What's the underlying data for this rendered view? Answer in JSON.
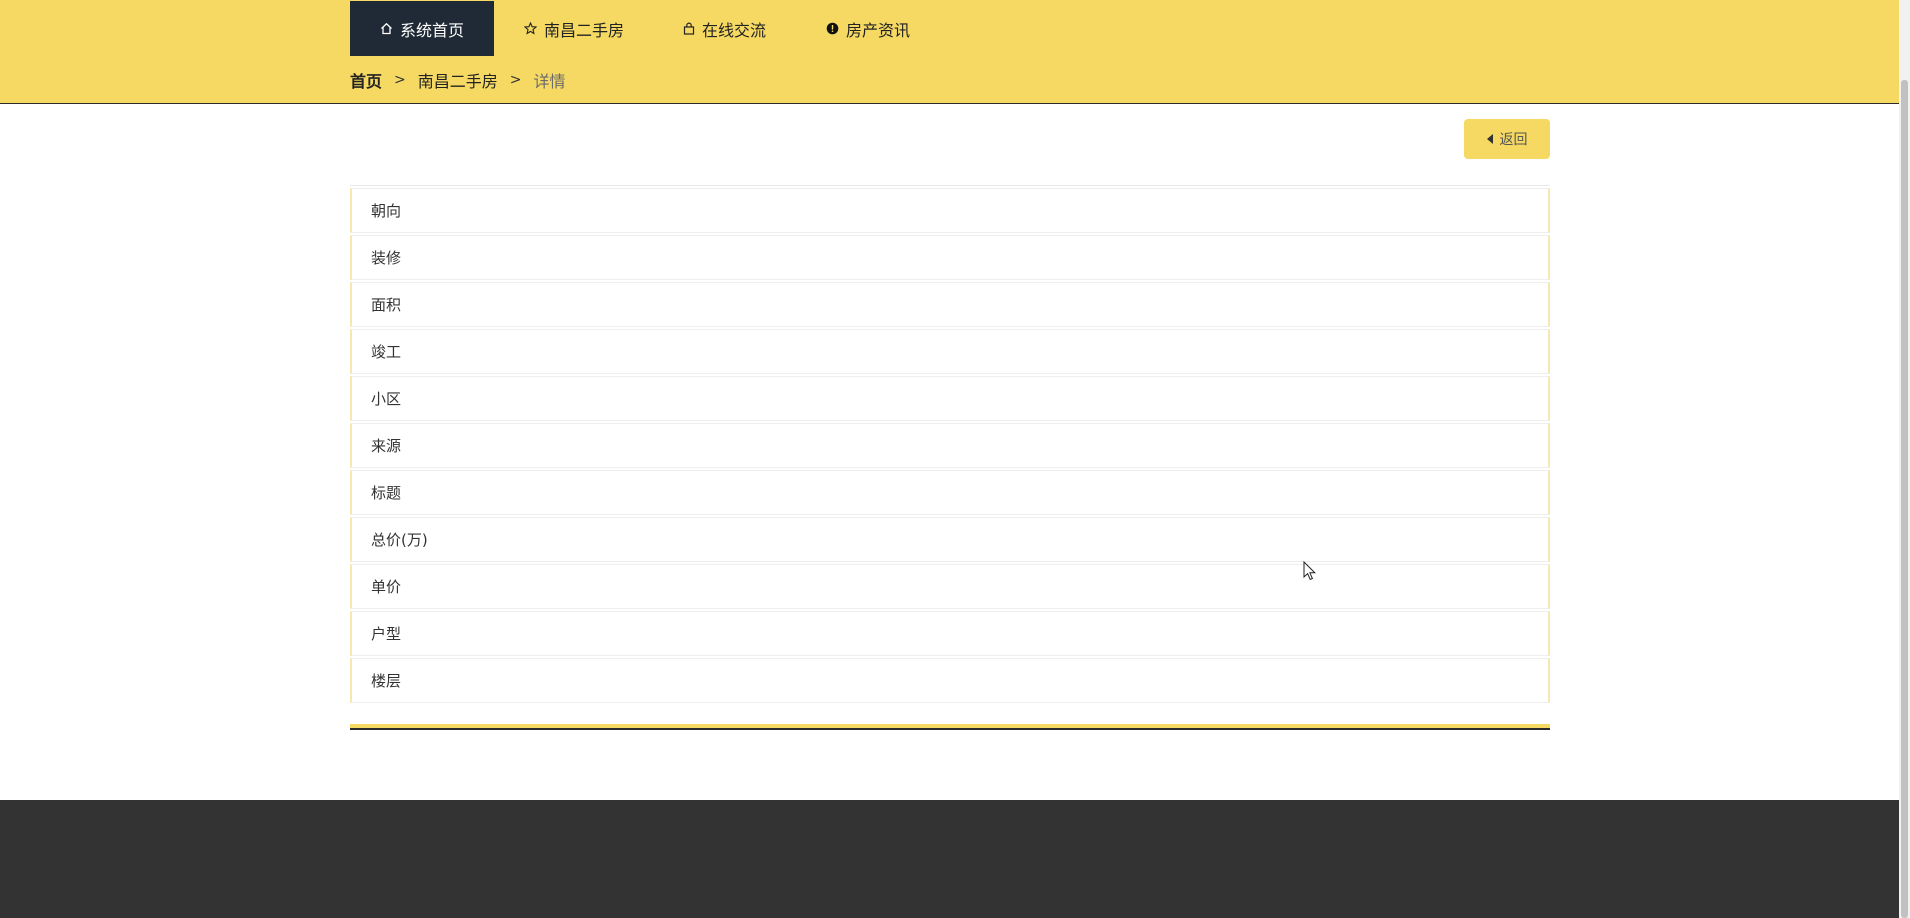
{
  "nav": {
    "items": [
      {
        "label": "系统首页",
        "icon": "home-icon",
        "active": true
      },
      {
        "label": "南昌二手房",
        "icon": "star-icon",
        "active": false
      },
      {
        "label": "在线交流",
        "icon": "bag-icon",
        "active": false
      },
      {
        "label": "房产资讯",
        "icon": "info-icon",
        "active": false
      }
    ]
  },
  "breadcrumb": {
    "home": "首页",
    "separator": ">",
    "section": "南昌二手房",
    "current": "详情"
  },
  "actions": {
    "back_label": "返回"
  },
  "details": {
    "rows": [
      {
        "label": "朝向"
      },
      {
        "label": "装修"
      },
      {
        "label": "面积"
      },
      {
        "label": "竣工"
      },
      {
        "label": "小区"
      },
      {
        "label": "来源"
      },
      {
        "label": "标题"
      },
      {
        "label": "总价(万)"
      },
      {
        "label": "单价"
      },
      {
        "label": "户型"
      },
      {
        "label": "楼层"
      }
    ]
  },
  "colors": {
    "header_bg": "#f5d962",
    "nav_active_bg": "#1f2a36",
    "footer_bg": "#333333"
  }
}
